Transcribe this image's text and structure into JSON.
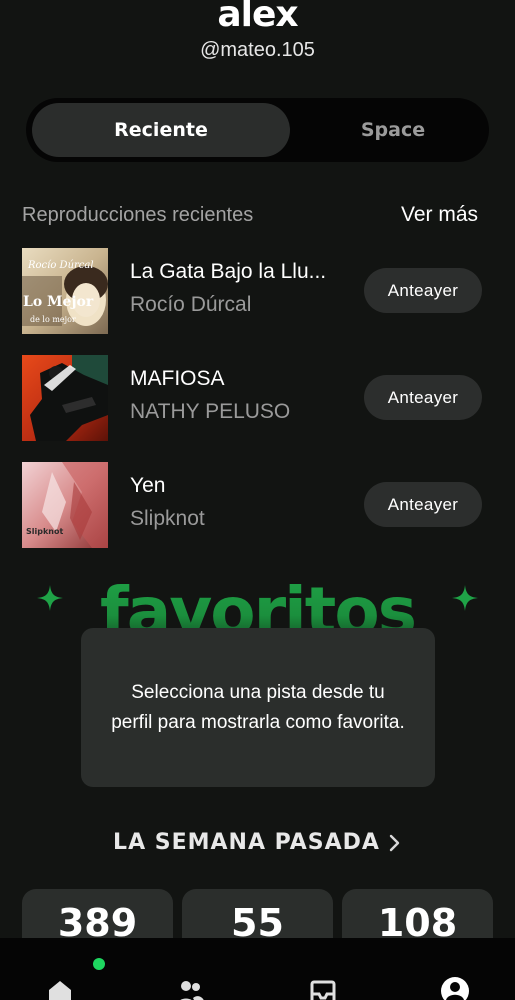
{
  "profile": {
    "name": "alex",
    "handle": "@mateo.105"
  },
  "tabs": [
    {
      "label": "Reciente",
      "active": true
    },
    {
      "label": "Space",
      "active": false
    }
  ],
  "recent": {
    "title": "Reproducciones recientes",
    "see_more": "Ver más",
    "tracks": [
      {
        "title": "La Gata Bajo la Llu...",
        "artist": "Rocío Dúrcal",
        "when": "Anteayer",
        "cover_text_top": "Rocío Dúrcal",
        "cover_text_main": "Lo Mejor",
        "cover_text_sub": "de lo mejor"
      },
      {
        "title": "MAFIOSA",
        "artist": "NATHY PELUSO",
        "when": "Anteayer"
      },
      {
        "title": "Yen",
        "artist": "Slipknot",
        "when": "Anteayer",
        "cover_text_main": "Slipknot"
      }
    ]
  },
  "favorites": {
    "title": "favoritos",
    "empty_message": "Selecciona una pista desde tu perfil para mostrarla como favorita.",
    "accent": "#1fa347"
  },
  "last_week": {
    "title": "LA SEMANA PASADA",
    "stats": [
      "389",
      "55",
      "108"
    ]
  },
  "nav": {
    "items": [
      "home-icon",
      "friends-icon",
      "inbox-icon",
      "profile-icon"
    ],
    "active_dot_color": "#1ed760"
  }
}
